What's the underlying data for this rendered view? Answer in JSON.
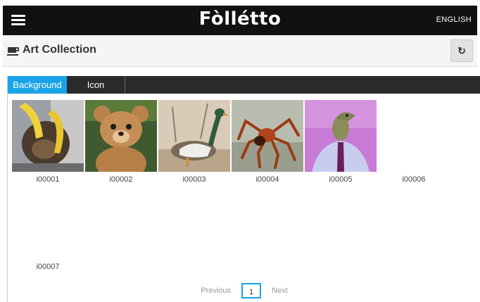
{
  "topbar": {
    "brand": "Fòllétto",
    "language": "ENGLISH"
  },
  "header": {
    "title": "Art Collection",
    "refresh_glyph": "↻",
    "title_icon": "coffee-cup-icon"
  },
  "tabs": [
    {
      "label": "Background",
      "active": true
    },
    {
      "label": "Icon",
      "active": false
    }
  ],
  "items": [
    {
      "id": "i00001",
      "image": "monkey with banana"
    },
    {
      "id": "i00002",
      "image": "teddy bear"
    },
    {
      "id": "i00003",
      "image": "duck"
    },
    {
      "id": "i00004",
      "image": "spider"
    },
    {
      "id": "i00005",
      "image": "lizard head in suit"
    },
    {
      "id": "i00006",
      "image": ""
    },
    {
      "id": "i00007",
      "image": ""
    }
  ],
  "pagination": {
    "previous": "Previous",
    "current": "1",
    "next": "Next"
  },
  "colors": {
    "accent": "#1aa3e8",
    "topbar": "#111111",
    "tabbar": "#2b2b2b"
  }
}
